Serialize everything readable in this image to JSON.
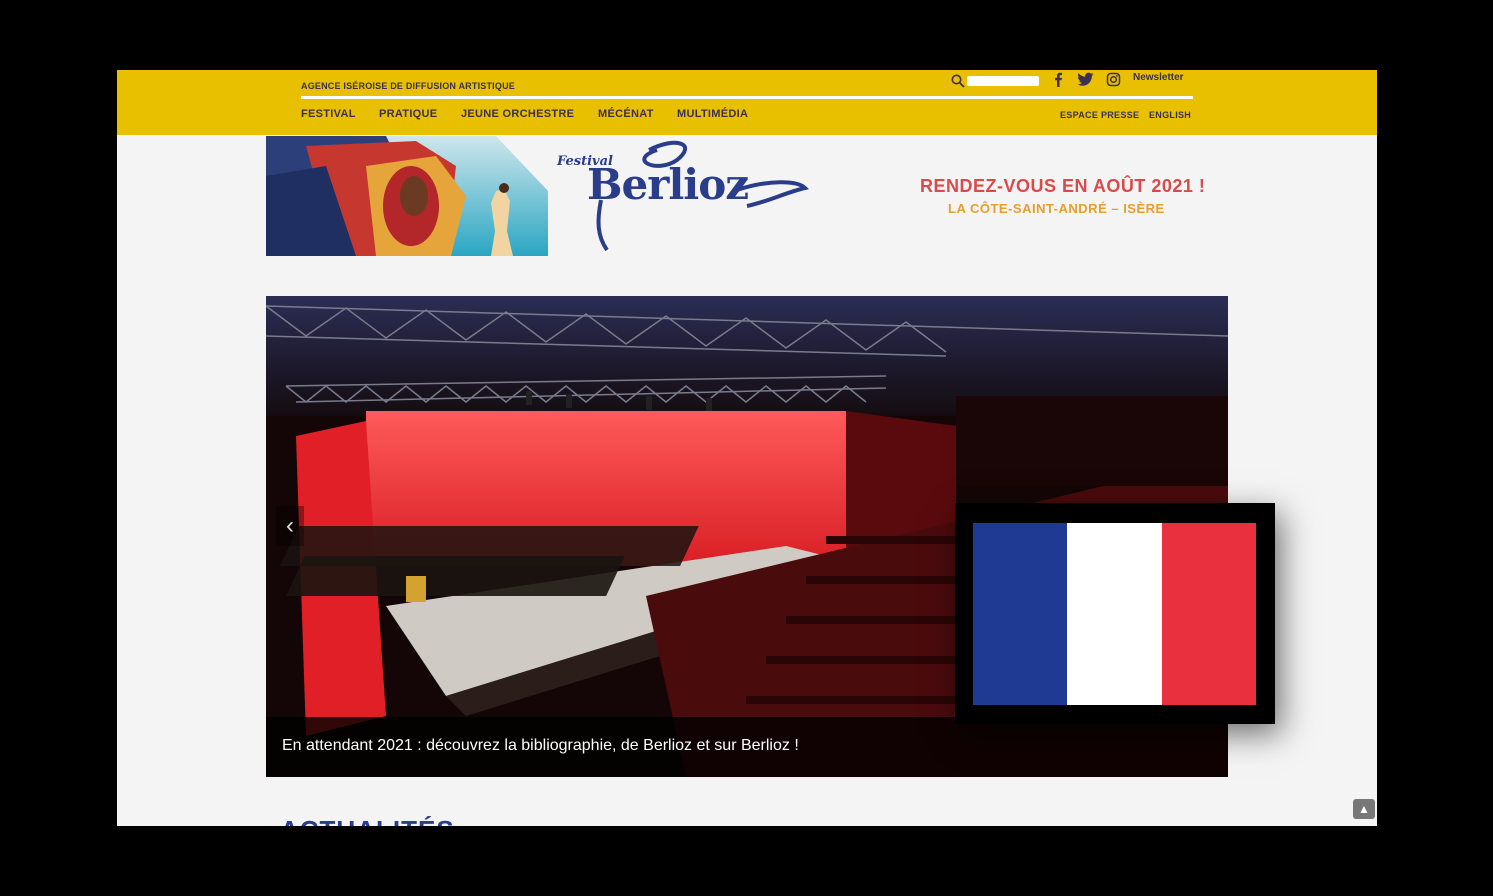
{
  "header": {
    "agency": "AGENCE ISÉROISE DE DIFFUSION ARTISTIQUE",
    "search": {
      "placeholder": ""
    },
    "social": [
      "facebook-icon",
      "twitter-icon",
      "instagram-icon"
    ],
    "newsletter": "Newsletter",
    "nav_main": [
      "FESTIVAL",
      "PRATIQUE",
      "JEUNE ORCHESTRE",
      "MÉCÉNAT",
      "MULTIMÉDIA"
    ],
    "nav_right": [
      "ESPACE PRESSE",
      "ENGLISH"
    ]
  },
  "banner": {
    "logo_small": "Festival",
    "logo_big": "Berlioz",
    "tagline": "RENDEZ-VOUS EN AOÛT 2021 !",
    "location": "LA CÔTE-SAINT-ANDRÉ – ISÈRE"
  },
  "slider": {
    "prev": "‹",
    "caption": "En attendant 2021 : découvrez la bibliographie, de Berlioz et sur Berlioz !"
  },
  "section": {
    "heading": "ACTUALITÉS"
  },
  "scroll_top": "▲",
  "colors": {
    "header_bg": "#e9c000",
    "brand_blue": "#2a3d8a",
    "tagline_red": "#d94b4b",
    "location_orange": "#e89e2c",
    "flag": [
      "#1f3a93",
      "#ffffff",
      "#e8303e"
    ]
  }
}
